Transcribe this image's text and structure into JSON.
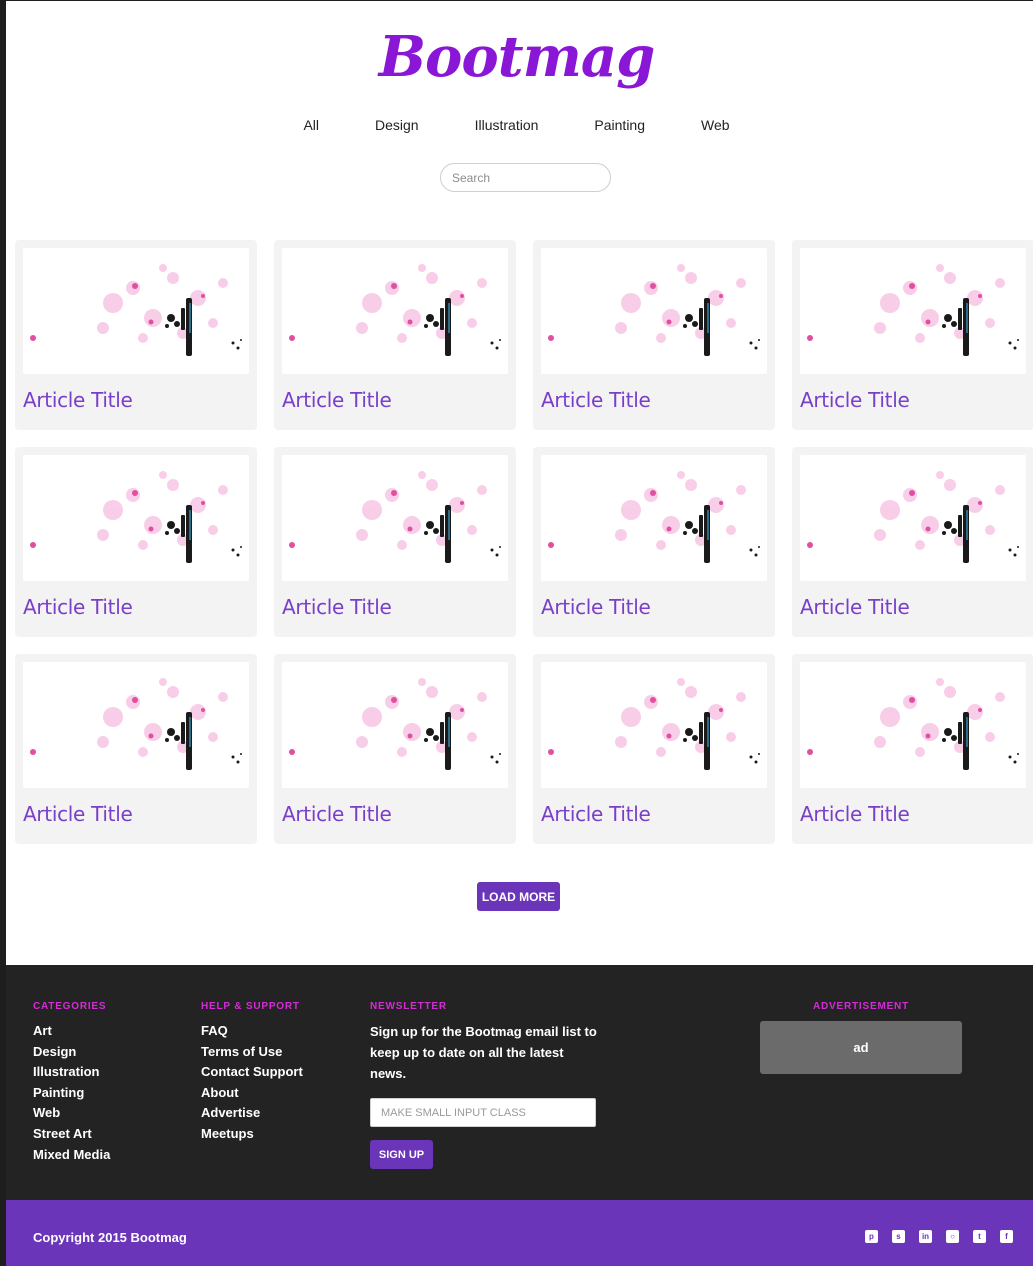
{
  "header": {
    "logo": "Bootmag",
    "nav": [
      "All",
      "Design",
      "Illustration",
      "Painting",
      "Web"
    ],
    "search_placeholder": "Search"
  },
  "articles": [
    {
      "title": "Article Title"
    },
    {
      "title": "Article Title"
    },
    {
      "title": "Article Title"
    },
    {
      "title": "Article Title"
    },
    {
      "title": "Article Title"
    },
    {
      "title": "Article Title"
    },
    {
      "title": "Article Title"
    },
    {
      "title": "Article Title"
    },
    {
      "title": "Article Title"
    },
    {
      "title": "Article Title"
    },
    {
      "title": "Article Title"
    },
    {
      "title": "Article Title"
    }
  ],
  "load_more_label": "LOAD MORE",
  "footer": {
    "categories": {
      "heading": "CATEGORIES",
      "items": [
        "Art",
        "Design",
        "Illustration",
        "Painting",
        "Web",
        "Street Art",
        "Mixed Media"
      ]
    },
    "help": {
      "heading": "HELP & SUPPORT",
      "items": [
        "FAQ",
        "Terms of Use",
        "Contact Support",
        "About",
        "Advertise",
        "Meetups"
      ]
    },
    "newsletter": {
      "heading": "NEWSLETTER",
      "text": "Sign up for the Bootmag email list to keep up to date on all the latest news.",
      "input_placeholder": "MAKE SMALL INPUT CLASS",
      "button": "SIGN UP"
    },
    "advertisement": {
      "heading": "ADVERTISEMENT",
      "ad_text": "ad"
    }
  },
  "bottombar": {
    "copyright": "Copyright 2015 Bootmag",
    "socials": [
      "pinterest-icon",
      "skype-icon",
      "linkedin-icon",
      "github-icon",
      "twitter-icon",
      "facebook-icon"
    ]
  },
  "colors": {
    "brand_purple": "#6a35b8",
    "logo_purple": "#8a16d6",
    "accent_magenta": "#d62bd9",
    "footer_dark": "#232323"
  }
}
